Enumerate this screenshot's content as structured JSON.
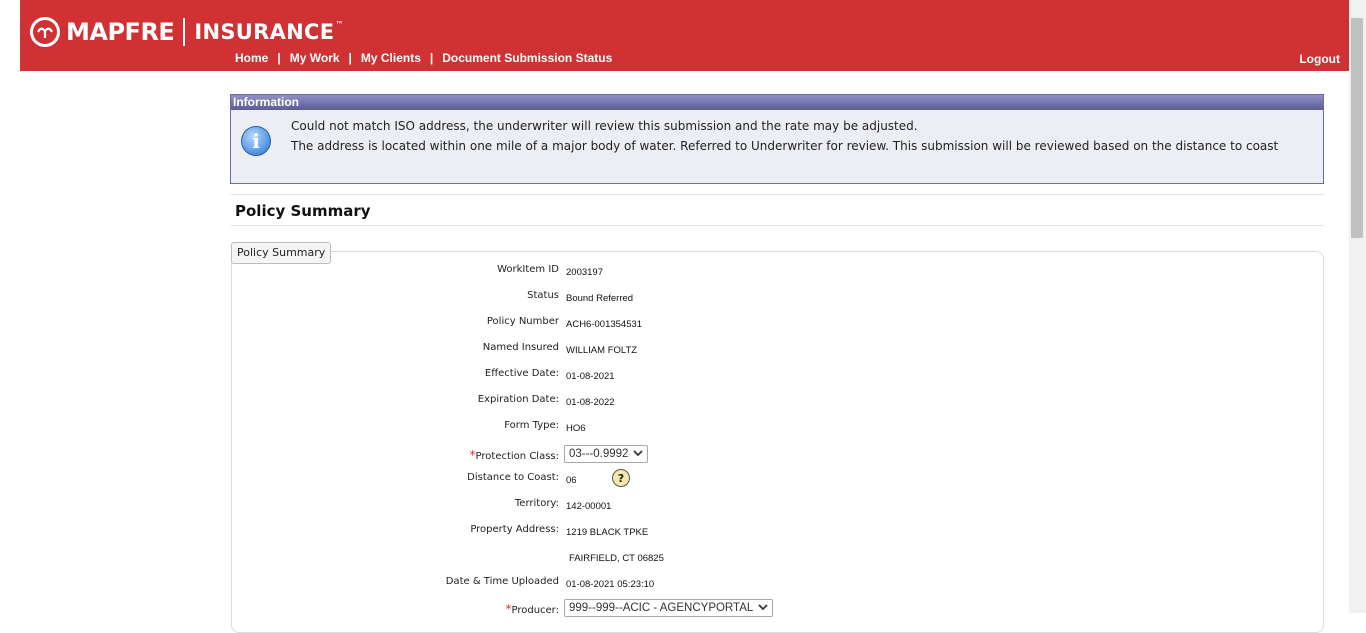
{
  "header": {
    "brand": "MAPFRE",
    "brand_suffix": "INSURANCE",
    "trademark": "™",
    "nav": [
      "Home",
      "My Work",
      "My Clients",
      "Document Submission Status"
    ],
    "nav_separator": "|",
    "logout": "Logout",
    "colors": {
      "bar": "#d03234",
      "text": "#ffffff"
    }
  },
  "information": {
    "title": "Information",
    "icon": "info-icon",
    "messages": [
      "Could not match ISO address, the underwriter will review this submission and the rate may be adjusted.",
      "The address is located within one mile of a major body of water. Referred to Underwriter for review. This submission will be reviewed based on the distance to coast"
    ]
  },
  "page": {
    "title": "Policy Summary",
    "tab_label": "Policy Summary"
  },
  "summary": {
    "workitem_id": {
      "label": "WorkItem ID",
      "value": "2003197"
    },
    "status": {
      "label": "Status",
      "value": "Bound Referred"
    },
    "policy_number": {
      "label": "Policy Number",
      "value": "ACH6-001354531"
    },
    "named_insured": {
      "label": "Named Insured",
      "value": "WILLIAM FOLTZ"
    },
    "effective_date": {
      "label": "Effective Date:",
      "value": "01-08-2021"
    },
    "expiration_date": {
      "label": "Expiration Date:",
      "value": "01-08-2022"
    },
    "form_type": {
      "label": "Form Type:",
      "value": "HO6"
    },
    "protection_class": {
      "label": "Protection Class:",
      "required_mark": "*",
      "value": "03---0.9992"
    },
    "distance_to_coast": {
      "label": "Distance to Coast:",
      "value": "06",
      "help": "?"
    },
    "territory": {
      "label": "Territory:",
      "value": "142-00001"
    },
    "property_address": {
      "label": "Property Address:",
      "line1": "1219 BLACK TPKE",
      "line2": "FAIRFIELD, CT 06825"
    },
    "date_time_uploaded": {
      "label": "Date & Time Uploaded",
      "value": "01-08-2021 05:23:10"
    },
    "producer": {
      "label": "Producer:",
      "required_mark": "*",
      "value": "999--999--ACIC - AGENCYPORTAL"
    }
  }
}
